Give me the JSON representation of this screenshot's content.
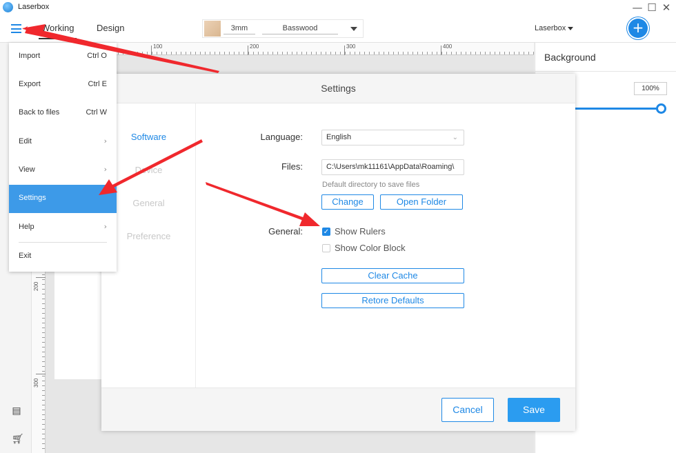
{
  "window": {
    "title": "Laserbox",
    "minimize_glyph": "—",
    "maximize_glyph": "☐",
    "close_glyph": "✕"
  },
  "toolbar": {
    "menu_icon": "hamburger-menu-icon",
    "tabs": [
      {
        "label": "Working",
        "active": true
      },
      {
        "label": "Design",
        "active": false
      }
    ],
    "material": {
      "thickness": "3mm",
      "name": "Basswood"
    },
    "device": {
      "label": "Laserbox"
    },
    "add_device_glyph": "+"
  },
  "ruler": {
    "top_labels": [
      "100",
      "200",
      "300",
      "400"
    ],
    "left_labels": [
      "200",
      "300"
    ]
  },
  "side_icons": [
    "notes-icon",
    "cart-icon"
  ],
  "right_panel": {
    "title": "Background",
    "opacity_value": "100%",
    "opacity_level": 1.0
  },
  "dropdown_menu": {
    "items": [
      {
        "label": "Import",
        "shortcut": "Ctrl O",
        "submenu": false,
        "active": false
      },
      {
        "label": "Export",
        "shortcut": "Ctrl E",
        "submenu": false,
        "active": false
      },
      {
        "label": "Back to files",
        "shortcut": "Ctrl W",
        "submenu": false,
        "active": false
      },
      {
        "label": "Edit",
        "shortcut": "",
        "submenu": true,
        "active": false
      },
      {
        "label": "View",
        "shortcut": "",
        "submenu": true,
        "active": false
      },
      {
        "label": "Settings",
        "shortcut": "",
        "submenu": false,
        "active": true
      },
      {
        "label": "Help",
        "shortcut": "",
        "submenu": true,
        "active": false
      },
      {
        "label": "Exit",
        "shortcut": "",
        "submenu": false,
        "active": false
      }
    ],
    "submenu_glyph": "›"
  },
  "settings": {
    "title": "Settings",
    "nav": [
      {
        "label": "Software",
        "active": true
      },
      {
        "label": "Device",
        "active": false
      },
      {
        "label": "General",
        "active": false
      },
      {
        "label": "Preference",
        "active": false
      }
    ],
    "language_label": "Language:",
    "language_value": "English",
    "files_label": "Files:",
    "files_value": "C:\\Users\\mk11161\\AppData\\Roaming\\",
    "files_hint": "Default directory to save files",
    "change_label": "Change",
    "open_folder_label": "Open Folder",
    "general_label": "General:",
    "show_rulers_label": "Show Rulers",
    "show_rulers_checked": true,
    "show_color_block_label": "Show Color Block",
    "show_color_block_checked": false,
    "check_glyph": "✓",
    "clear_cache_label": "Clear Cache",
    "restore_defaults_label": "Retore Defaults",
    "cancel_label": "Cancel",
    "save_label": "Save"
  },
  "colors": {
    "accent": "#1e88e5",
    "menu_highlight": "#3d9ae8",
    "save_button": "#2b9cf0",
    "annotation_arrow": "#f0282d"
  }
}
